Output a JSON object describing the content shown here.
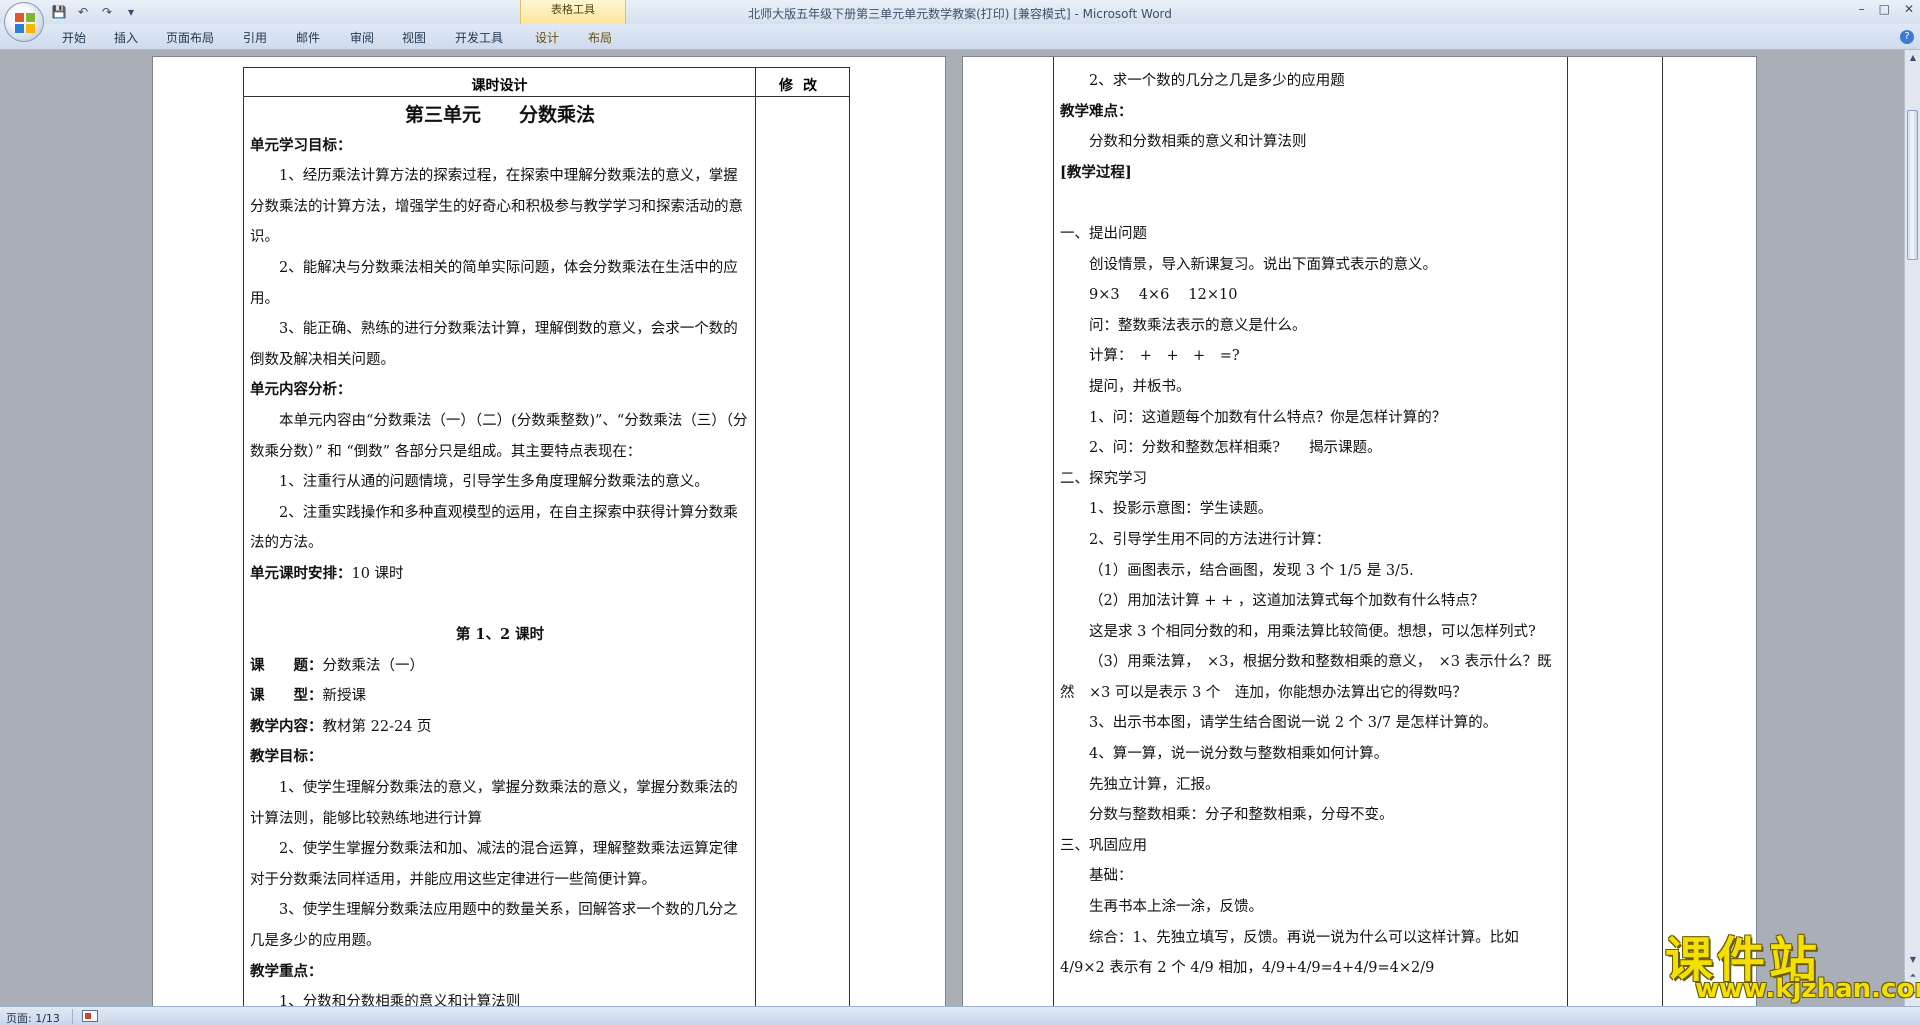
{
  "window": {
    "title": "北师大版五年级下册第三单元单元数学教案(打印) [兼容模式] - Microsoft Word",
    "context_tab_group": "表格工具",
    "controls": {
      "minimize": "–",
      "maximize": "□",
      "close": "✕"
    }
  },
  "qat": {
    "save": "💾",
    "undo": "↶",
    "redo": "↷",
    "more": "▾"
  },
  "ribbon": {
    "tabs": [
      "开始",
      "插入",
      "页面布局",
      "引用",
      "邮件",
      "审阅",
      "视图",
      "开发工具",
      "设计",
      "布局"
    ],
    "help": "?"
  },
  "page1": {
    "header_left": "课时设计",
    "header_right": "修改",
    "unit_title": "第三单元　　分数乘法",
    "unit_goals_label": "单元学习目标：",
    "goal_1": "1、经历乘法计算方法的探索过程，在探索中理解分数乘法的意义，掌握分数乘法的计算方法，增强学生的好奇心和积极参与教学学习和探索活动的意识。",
    "goal_2": "2、能解决与分数乘法相关的简单实际问题，体会分数乘法在生活中的应用。",
    "goal_3": "3、能正确、熟练的进行分数乘法计算，理解倒数的意义，会求一个数的倒数及解决相关问题。",
    "content_label": "单元内容分析：",
    "content_text": "本单元内容由“分数乘法（一）（二）(分数乘整数)”、“分数乘法（三）（分数乘分数）” 和 “倒数” 各部分只是组成。其主要特点表现在：",
    "feature_1": "1、注重行从通的问题情境，引导学生多角度理解分数乘法的意义。",
    "feature_2": "2、注重实践操作和多种直观模型的运用，在自主探索中获得计算分数乘法的方法。",
    "schedule_label": "单元课时安排：",
    "schedule_value": "10 课时",
    "lesson_heading": "第 1、2 课时",
    "topic_label": "课　　题：",
    "topic_value": "分数乘法（一）",
    "type_label": "课　　型：",
    "type_value": "新授课",
    "teach_content_label": "教学内容：",
    "teach_content_value": "教材第 22-24 页",
    "teach_goals_label": "教学目标：",
    "tgoal_1": "1、使学生理解分数乘法的意义，掌握分数乘法的意义，掌握分数乘法的计算法则，能够比较熟练地进行计算",
    "tgoal_2": "2、使学生掌握分数乘法和加、减法的混合运算，理解整数乘法运算定律对于分数乘法同样适用，并能应用这些定律进行一些简便计算。",
    "tgoal_3": "3、使学生理解分数乘法应用题中的数量关系，回解答求一个数的几分之几是多少的应用题。",
    "key_label": "教学重点：",
    "key_1": "1、分数和分数相乘的意义和计算法则"
  },
  "page2": {
    "l1": "2、求一个数的几分之几是多少的应用题",
    "difficulty_label": "教学难点：",
    "l2": "分数和分数相乘的意义和计算法则",
    "process_label": "[教学过程]",
    "s1": "一、提出问题",
    "l3": "创设情景，导入新课复习。说出下面算式表示的意义。",
    "l4": "9×3　 4×6　 12×10",
    "l5": "问：整数乘法表示的意义是什么。",
    "l6": "计算：　+　+　+　=?",
    "l7": "提问，并板书。",
    "l8": "1、问：这道题每个加数有什么特点？你是怎样计算的？",
    "l9": "2、问：分数和整数怎样相乘?　　揭示课题。",
    "s2": "二、探究学习",
    "l10": "1、投影示意图：学生读题。",
    "l11": "2、引导学生用不同的方法进行计算：",
    "l12": "（1）画图表示，结合画图，发现 3 个 1/5 是 3/5.",
    "l13": "（2）用加法计算 + + ，这道加法算式每个加数有什么特点？",
    "l14": "这是求 3 个相同分数的和，用乘法算比较简便。想想，可以怎样列式?",
    "l15": "（3）用乘法算，　×3，根据分数和整数相乘的意义，　×3 表示什么？既然　×3 可以是表示 3 个　连加，你能想办法算出它的得数吗？",
    "l16": "3、出示书本图，请学生结合图说一说 2 个 3/7 是怎样计算的。",
    "l17": "4、算一算，说一说分数与整数相乘如何计算。",
    "l18": "先独立计算，汇报。",
    "l19": "分数与整数相乘：分子和整数相乘，分母不变。",
    "s3": "三、巩固应用",
    "l20": "基础：",
    "l21": "生再书本上涂一涂，反馈。",
    "l22": "综合：1、先独立填写，反馈。再说一说为什么可以这样计算。比如 4/9×2 表示有 2 个 4/9 相加，4/9+4/9=4+4/9=4×2/9"
  },
  "status": {
    "page": "页面: 1/13"
  },
  "watermark": {
    "brand": "课件站",
    "url": "www.kjzhan.com"
  }
}
